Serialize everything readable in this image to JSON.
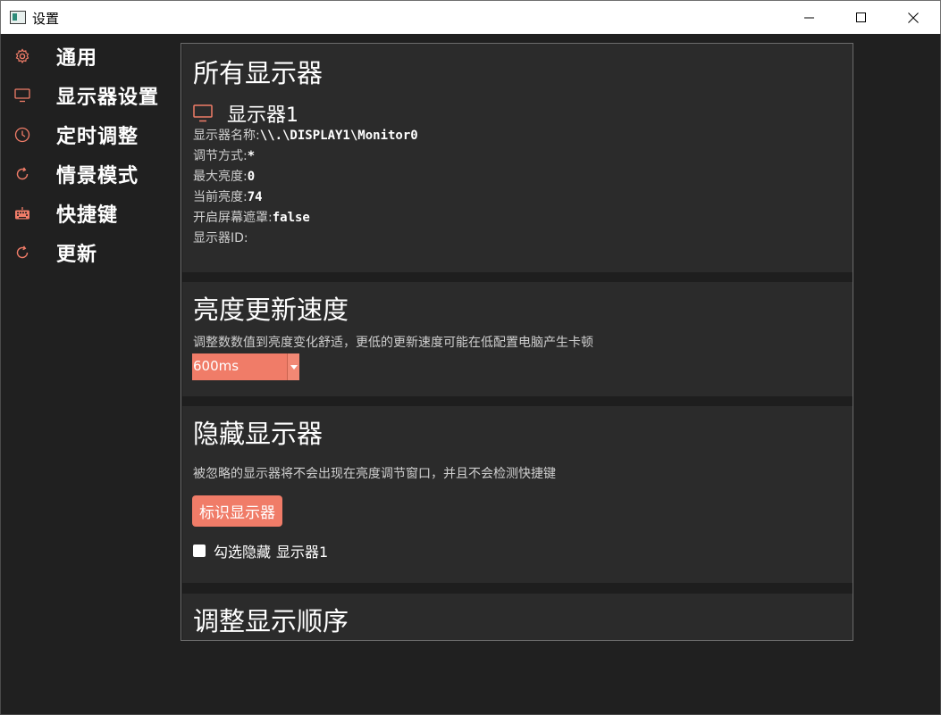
{
  "window": {
    "title": "设置"
  },
  "sidebar": {
    "items": [
      {
        "label": "通用",
        "icon": "gear-icon"
      },
      {
        "label": "显示器设置",
        "icon": "monitor-icon"
      },
      {
        "label": "定时调整",
        "icon": "clock-icon"
      },
      {
        "label": "情景模式",
        "icon": "refresh-icon"
      },
      {
        "label": "快捷键",
        "icon": "keyboard-icon"
      },
      {
        "label": "更新",
        "icon": "refresh-icon"
      }
    ]
  },
  "all_monitors": {
    "title": "所有显示器",
    "monitor": {
      "name": "显示器1",
      "fields": [
        {
          "label": "显示器名称:",
          "value": "\\\\.\\DISPLAY1\\Monitor0"
        },
        {
          "label": "调节方式:",
          "value": "*"
        },
        {
          "label": "最大亮度:",
          "value": "0"
        },
        {
          "label": "当前亮度:",
          "value": "74"
        },
        {
          "label": "开启屏幕遮罩:",
          "value": "false"
        },
        {
          "label": "显示器ID:",
          "value": ""
        }
      ]
    }
  },
  "update_speed": {
    "title": "亮度更新速度",
    "description": "调整数数值到亮度变化舒适，更低的更新速度可能在低配置电脑产生卡顿",
    "selected": "600ms"
  },
  "hide_monitors": {
    "title": "隐藏显示器",
    "description": "被忽略的显示器将不会出现在亮度调节窗口，并且不会检测快捷键",
    "identify_button": "标识显示器",
    "checkbox_label": "勾选隐藏",
    "checkbox_monitor": "显示器1",
    "checked": false
  },
  "order": {
    "title": "调整显示顺序"
  },
  "colors": {
    "accent": "#f07c68",
    "background": "#202020",
    "card": "#2b2b2b"
  }
}
